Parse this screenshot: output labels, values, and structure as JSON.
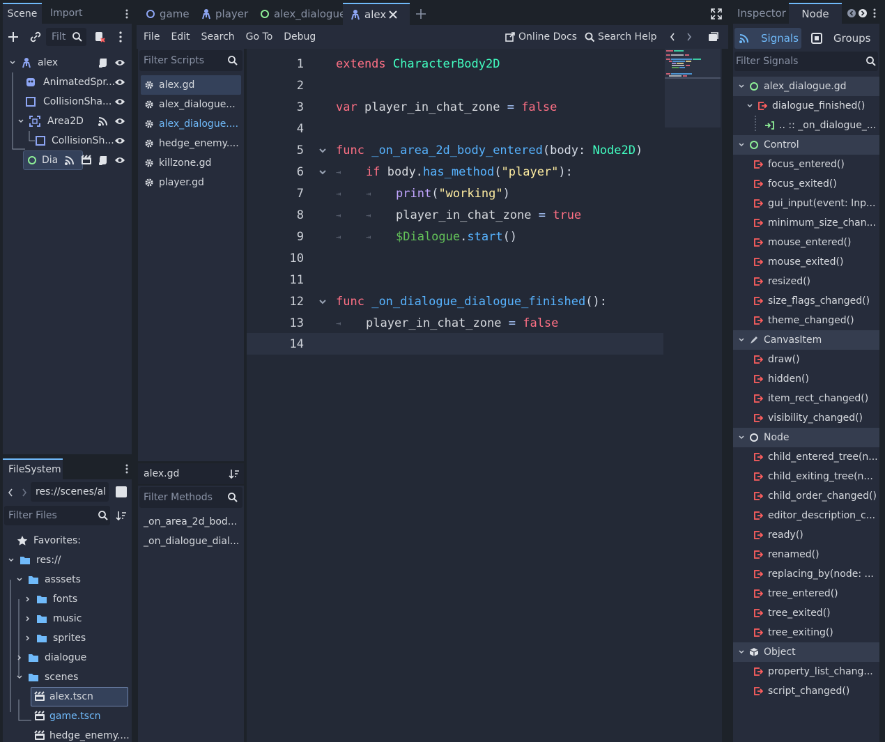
{
  "left_top": {
    "tabs": [
      "Scene",
      "Import"
    ],
    "filter_placeholder": "Filt",
    "tree": [
      {
        "label": "alex"
      },
      {
        "label": "AnimatedSpr..."
      },
      {
        "label": "CollisionSha..."
      },
      {
        "label": "Area2D"
      },
      {
        "label": "CollisionSh..."
      },
      {
        "label": "Dia"
      }
    ]
  },
  "filesystem": {
    "title": "FileSystem",
    "path": "res://scenes/al",
    "filter_placeholder": "Filter Files",
    "items": [
      {
        "label": "Favorites:"
      },
      {
        "label": "res://"
      },
      {
        "label": "asssets"
      },
      {
        "label": "fonts"
      },
      {
        "label": "music"
      },
      {
        "label": "sprites"
      },
      {
        "label": "dialogue"
      },
      {
        "label": "scenes"
      },
      {
        "label": "alex.tscn"
      },
      {
        "label": "game.tscn"
      },
      {
        "label": "hedge_enemy...."
      }
    ]
  },
  "tabs": {
    "items": [
      {
        "label": "game"
      },
      {
        "label": "player"
      },
      {
        "label": "alex_dialogue"
      },
      {
        "label": "alex"
      }
    ]
  },
  "menu": {
    "items": [
      "File",
      "Edit",
      "Search",
      "Go To",
      "Debug"
    ],
    "online_docs": "Online Docs",
    "search_help": "Search Help"
  },
  "scripts": {
    "filter_placeholder": "Filter Scripts",
    "items": [
      "alex.gd",
      "alex_dialogue...",
      "alex_dialogue....",
      "hedge_enemy....",
      "killzone.gd",
      "player.gd"
    ],
    "current": "alex.gd",
    "methods_placeholder": "Filter Methods",
    "methods": [
      "_on_area_2d_bod...",
      "_on_dialogue_dial..."
    ]
  },
  "code": {
    "line_numbers": [
      "1",
      "2",
      "3",
      "4",
      "5",
      "6",
      "7",
      "8",
      "9",
      "10",
      "11",
      "12",
      "13",
      "14"
    ],
    "l1_kw": "extends",
    "l1_type": "CharacterBody2D",
    "l3_kw": "var",
    "l3_name": "player_in_chat_zone",
    "l3_eq": "=",
    "l3_val": "false",
    "l5_kw": "func",
    "l5_fn": "_on_area_2d_body_entered",
    "l5_p1": "(body:",
    "l5_type": "Node2D",
    "l5_p2": ")",
    "l6_kw": "if",
    "l6_a": "body.",
    "l6_fn": "has_method",
    "l6_p1": "(",
    "l6_str": "\"player\"",
    "l6_p2": "):",
    "l7_fn": "print",
    "l7_p1": "(",
    "l7_str": "\"working\"",
    "l7_p2": ")",
    "l8_name": "player_in_chat_zone",
    "l8_eq": "=",
    "l8_val": "true",
    "l9_node": "$Dialogue",
    "l9_dot": ".",
    "l9_fn": "start",
    "l9_p": "()",
    "l12_kw": "func",
    "l12_fn": "_on_dialogue_dialogue_finished",
    "l12_p": "():",
    "l13_name": "player_in_chat_zone",
    "l13_eq": "=",
    "l13_val": "false"
  },
  "right": {
    "tabs": [
      "Inspector",
      "Node"
    ],
    "subtabs": [
      "Signals",
      "Groups"
    ],
    "filter_placeholder": "Filter Signals",
    "rows": [
      {
        "label": "alex_dialogue.gd"
      },
      {
        "label": "dialogue_finished()"
      },
      {
        "label": ".. :: _on_dialogue_..."
      },
      {
        "label": "Control"
      },
      {
        "label": "focus_entered()"
      },
      {
        "label": "focus_exited()"
      },
      {
        "label": "gui_input(event: Inp..."
      },
      {
        "label": "minimum_size_chan..."
      },
      {
        "label": "mouse_entered()"
      },
      {
        "label": "mouse_exited()"
      },
      {
        "label": "resized()"
      },
      {
        "label": "size_flags_changed()"
      },
      {
        "label": "theme_changed()"
      },
      {
        "label": "CanvasItem"
      },
      {
        "label": "draw()"
      },
      {
        "label": "hidden()"
      },
      {
        "label": "item_rect_changed()"
      },
      {
        "label": "visibility_changed()"
      },
      {
        "label": "Node"
      },
      {
        "label": "child_entered_tree(n..."
      },
      {
        "label": "child_exiting_tree(n..."
      },
      {
        "label": "child_order_changed()"
      },
      {
        "label": "editor_description_c..."
      },
      {
        "label": "ready()"
      },
      {
        "label": "renamed()"
      },
      {
        "label": "replacing_by(node: ..."
      },
      {
        "label": "tree_entered()"
      },
      {
        "label": "tree_exited()"
      },
      {
        "label": "tree_exiting()"
      },
      {
        "label": "Object"
      },
      {
        "label": "property_list_chang..."
      },
      {
        "label": "script_changed()"
      }
    ]
  },
  "colors": {
    "accent": "#70bafa",
    "background": "#1d2229",
    "panel": "#262c3b",
    "signal_red": "#ff5f5f",
    "node_green": "#8eef97"
  }
}
